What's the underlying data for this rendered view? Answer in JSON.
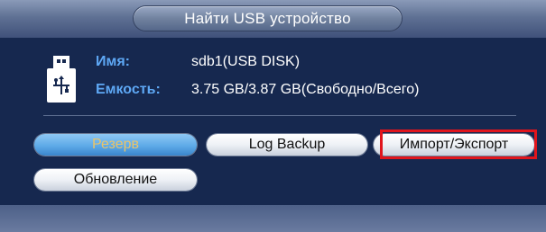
{
  "dialog": {
    "title": "Найти USB устройство"
  },
  "device": {
    "name_label": "Имя:",
    "name_value": "sdb1(USB DISK)",
    "capacity_label": "Емкость:",
    "capacity_value": "3.75 GB/3.87 GB(Свободно/Всего)"
  },
  "buttons": {
    "backup": "Резерв",
    "log_backup": "Log Backup",
    "import_export": "Импорт/Экспорт",
    "update": "Обновление"
  },
  "colors": {
    "background": "#1b2c52",
    "label_blue": "#5ea8f5",
    "highlight_red": "#e0151d",
    "active_button": "#5eaae8",
    "active_text": "#e9c46a"
  },
  "icons": {
    "device": "usb-drive-icon"
  }
}
